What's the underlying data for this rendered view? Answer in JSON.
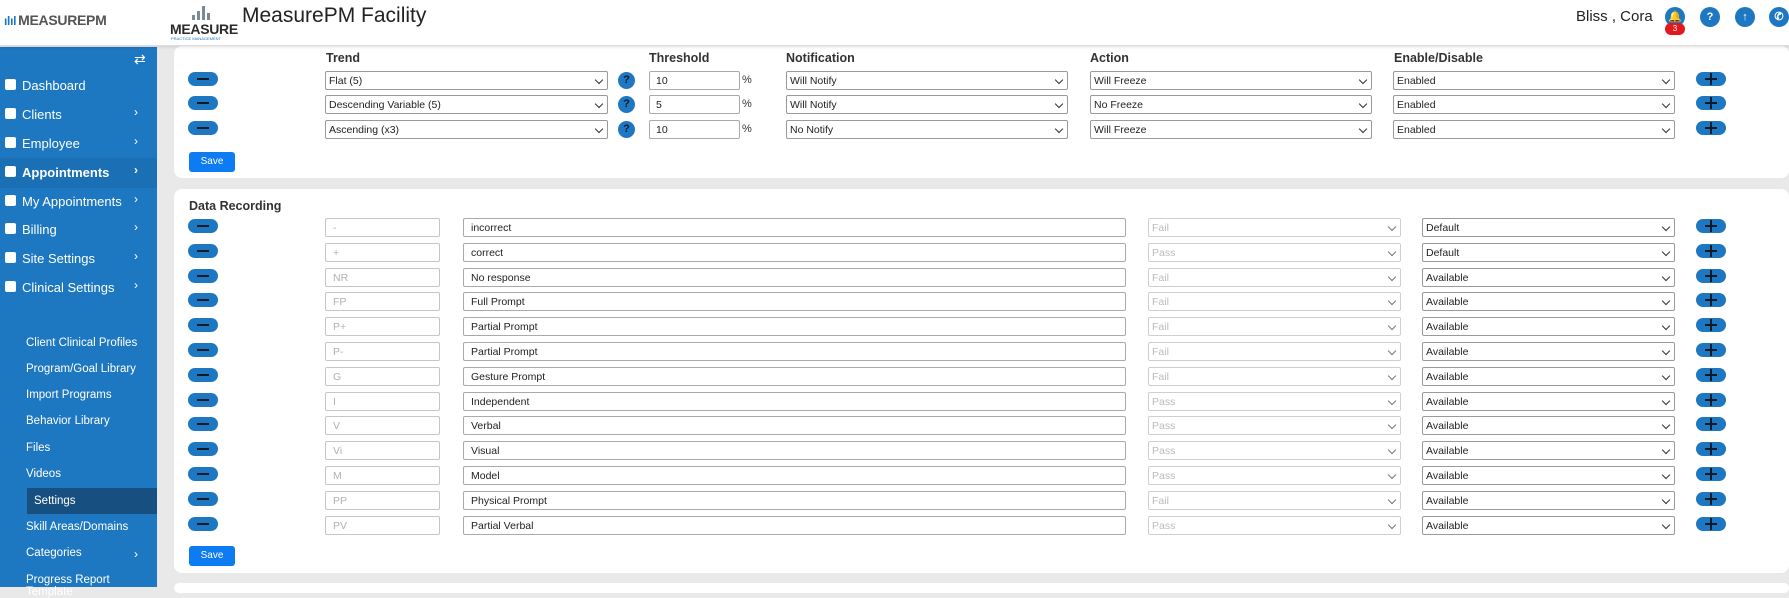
{
  "header": {
    "brand": "MEASUREPM",
    "logo_word": "MEASURE",
    "logo_sub": "PRACTICE MANAGEMENT",
    "title": "MeasurePM Facility",
    "user": "Bliss , Cora",
    "notification_count": "3",
    "icons": [
      "bell-icon",
      "help-icon",
      "upload-icon",
      "phone-icon"
    ]
  },
  "sidebar": {
    "toggle_icon": "⇄",
    "items": [
      {
        "label": "Dashboard",
        "chevron": ""
      },
      {
        "label": "Clients",
        "chevron": "›"
      },
      {
        "label": "Employee",
        "chevron": "›"
      },
      {
        "label": "Appointments",
        "chevron": "›"
      },
      {
        "label": "My Appointments",
        "chevron": "›"
      },
      {
        "label": "Billing",
        "chevron": "›"
      },
      {
        "label": "Site Settings",
        "chevron": "›"
      },
      {
        "label": "Clinical Settings",
        "chevron": "›"
      }
    ],
    "sub_items": [
      {
        "label": "Client Clinical Profiles"
      },
      {
        "label": "Program/Goal Library"
      },
      {
        "label": "Import Programs"
      },
      {
        "label": "Behavior Library"
      },
      {
        "label": "Files"
      },
      {
        "label": "Videos"
      },
      {
        "label": "Settings"
      },
      {
        "label": "Skill Areas/Domains"
      },
      {
        "label": "Categories",
        "chevron": "›"
      },
      {
        "label": "Progress Report Template"
      }
    ]
  },
  "trend_section": {
    "columns": {
      "trend": "Trend",
      "threshold": "Threshold",
      "notification": "Notification",
      "action": "Action",
      "enable": "Enable/Disable"
    },
    "help_icon": "?",
    "percent": "%",
    "rows": [
      {
        "trend": "Flat (5)",
        "threshold": "10",
        "notification": "Will Notify",
        "action": "Will Freeze",
        "enable": "Enabled"
      },
      {
        "trend": "Descending Variable (5)",
        "threshold": "5",
        "notification": "Will Notify",
        "action": "No Freeze",
        "enable": "Enabled"
      },
      {
        "trend": "Ascending (x3)",
        "threshold": "10",
        "notification": "No Notify",
        "action": "Will Freeze",
        "enable": "Enabled"
      }
    ],
    "save_label": "Save"
  },
  "data_recording": {
    "title": "Data Recording",
    "rows": [
      {
        "code": "-",
        "description": "incorrect",
        "result": "Fail",
        "status": "Default"
      },
      {
        "code": "+",
        "description": "correct",
        "result": "Pass",
        "status": "Default"
      },
      {
        "code": "NR",
        "description": "No response",
        "result": "Fail",
        "status": "Available"
      },
      {
        "code": "FP",
        "description": "Full Prompt",
        "result": "Fail",
        "status": "Available"
      },
      {
        "code": "P+",
        "description": "Partial Prompt",
        "result": "Fail",
        "status": "Available"
      },
      {
        "code": "P-",
        "description": "Partial Prompt",
        "result": "Fail",
        "status": "Available"
      },
      {
        "code": "G",
        "description": "Gesture Prompt",
        "result": "Fail",
        "status": "Available"
      },
      {
        "code": "I",
        "description": "Independent",
        "result": "Pass",
        "status": "Available"
      },
      {
        "code": "V",
        "description": "Verbal",
        "result": "Pass",
        "status": "Available"
      },
      {
        "code": "Vi",
        "description": "Visual",
        "result": "Pass",
        "status": "Available"
      },
      {
        "code": "M",
        "description": "Model",
        "result": "Pass",
        "status": "Available"
      },
      {
        "code": "PP",
        "description": "Physical Prompt",
        "result": "Fail",
        "status": "Available"
      },
      {
        "code": "PV",
        "description": "Partial Verbal",
        "result": "Pass",
        "status": "Available"
      }
    ],
    "save_label": "Save"
  },
  "colors": {
    "primary": "#1d78c1",
    "save": "#0d7bf2",
    "badge": "#e3181d",
    "active_sub": "#164f80"
  }
}
